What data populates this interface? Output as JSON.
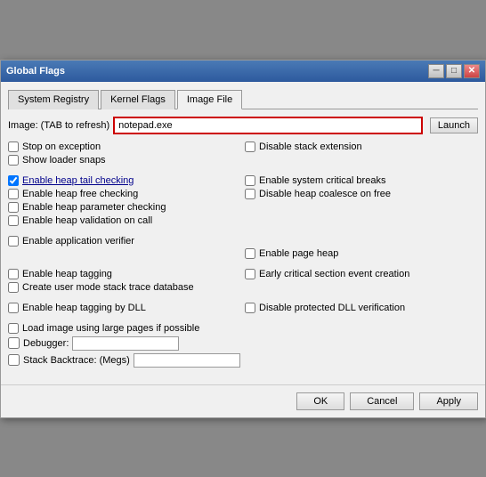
{
  "window": {
    "title": "Global Flags"
  },
  "tabs": [
    {
      "id": "system-registry",
      "label": "System Registry",
      "active": false
    },
    {
      "id": "kernel-flags",
      "label": "Kernel Flags",
      "active": false
    },
    {
      "id": "image-file",
      "label": "Image File",
      "active": true
    }
  ],
  "image_section": {
    "label": "Image: (TAB to refresh)",
    "value": "notepad.exe",
    "launch_label": "Launch"
  },
  "checkboxes": {
    "left_col_1": [
      {
        "id": "stop-exception",
        "label": "Stop on exception",
        "checked": false,
        "underline": false
      },
      {
        "id": "show-loader-snaps",
        "label": "Show loader snaps",
        "checked": false,
        "underline": false
      }
    ],
    "right_col_1": [
      {
        "id": "disable-stack-extension",
        "label": "Disable stack extension",
        "checked": false,
        "underline": false
      }
    ],
    "left_col_2": [
      {
        "id": "enable-heap-tail-checking",
        "label": "Enable heap tail checking",
        "checked": true,
        "underline": true
      },
      {
        "id": "enable-heap-free-checking",
        "label": "Enable heap free checking",
        "checked": false,
        "underline": false
      },
      {
        "id": "enable-heap-parameter-checking",
        "label": "Enable heap parameter checking",
        "checked": false,
        "underline": false
      },
      {
        "id": "enable-heap-validation-on-call",
        "label": "Enable heap validation on call",
        "checked": false,
        "underline": false
      }
    ],
    "right_col_2": [
      {
        "id": "enable-system-critical-breaks",
        "label": "Enable system critical breaks",
        "checked": false,
        "underline": false
      },
      {
        "id": "disable-heap-coalesce-on-free",
        "label": "Disable heap coalesce on free",
        "checked": false,
        "underline": false
      }
    ],
    "left_col_3": [
      {
        "id": "enable-application-verifier",
        "label": "Enable application verifier",
        "checked": false,
        "underline": false
      }
    ],
    "right_col_3": [
      {
        "id": "enable-page-heap",
        "label": "Enable page heap",
        "checked": false,
        "underline": false
      }
    ],
    "left_col_4": [
      {
        "id": "enable-heap-tagging",
        "label": "Enable heap tagging",
        "checked": false,
        "underline": false
      },
      {
        "id": "create-user-mode-stack-trace",
        "label": "Create user mode stack trace database",
        "checked": false,
        "underline": false
      }
    ],
    "right_col_4": [
      {
        "id": "early-critical-section-event-creation",
        "label": "Early critical section event creation",
        "checked": false,
        "underline": false
      }
    ],
    "left_col_5": [
      {
        "id": "enable-heap-tagging-by-dll",
        "label": "Enable heap tagging by DLL",
        "checked": false,
        "underline": false
      }
    ],
    "right_col_5": [
      {
        "id": "disable-protected-dll-verification",
        "label": "Disable protected DLL verification",
        "checked": false,
        "underline": false
      }
    ],
    "left_col_6": [
      {
        "id": "load-image-large-pages",
        "label": "Load image using large pages if possible",
        "checked": false,
        "underline": false
      }
    ]
  },
  "fields": {
    "debugger_label": "Debugger:",
    "stack_backtrace_label": "Stack Backtrace: (Megs)"
  },
  "buttons": {
    "ok": "OK",
    "cancel": "Cancel",
    "apply": "Apply"
  }
}
